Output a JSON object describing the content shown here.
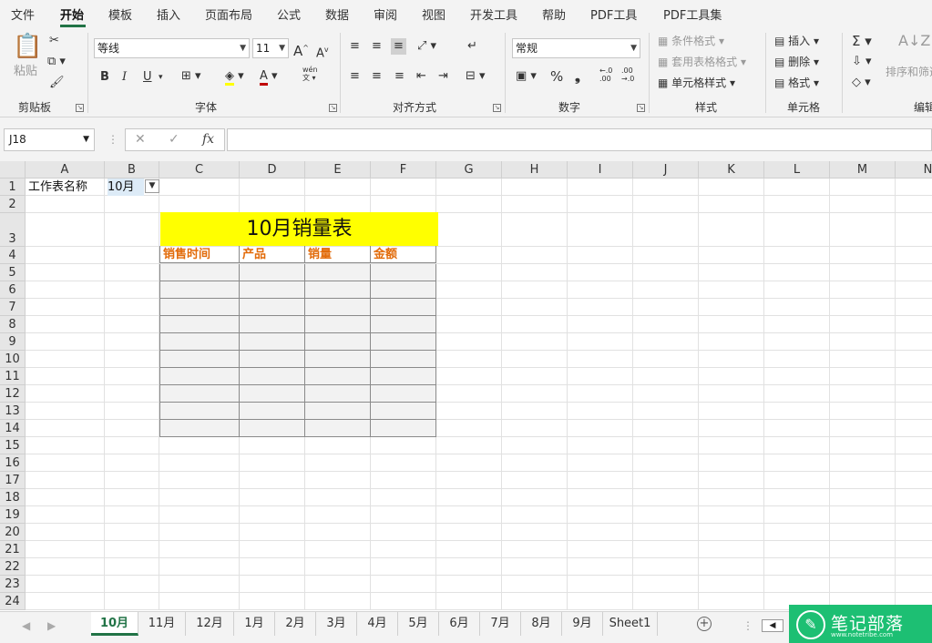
{
  "menu_tabs": [
    "文件",
    "开始",
    "模板",
    "插入",
    "页面布局",
    "公式",
    "数据",
    "审阅",
    "视图",
    "开发工具",
    "帮助",
    "PDF工具",
    "PDF工具集"
  ],
  "active_tab": "开始",
  "ribbon": {
    "clipboard": {
      "label": "剪贴板",
      "paste": "粘贴"
    },
    "font": {
      "label": "字体",
      "name": "等线",
      "size": "11",
      "grow": "A",
      "shrink": "A",
      "bold": "B",
      "italic": "I",
      "underline": "U",
      "phonetic": "wén"
    },
    "alignment": {
      "label": "对齐方式"
    },
    "number": {
      "label": "数字",
      "format": "常规",
      "percent": "%",
      "comma": "❟",
      "inc_decimal": "←.0\n.00",
      "dec_decimal": ".00\n→.0"
    },
    "styles": {
      "label": "样式",
      "conditional": "条件格式",
      "table_format": "套用表格格式",
      "cell_styles": "单元格样式"
    },
    "cells": {
      "label": "单元格",
      "insert": "插入",
      "delete": "删除",
      "format": "格式"
    },
    "editing": {
      "label": "编辑",
      "sort_filter": "排序和筛选"
    }
  },
  "formula_bar": {
    "name_box": "J18",
    "fx": "fx",
    "content": ""
  },
  "columns": [
    "A",
    "B",
    "C",
    "D",
    "E",
    "F",
    "G",
    "H",
    "I",
    "J",
    "K",
    "L",
    "M",
    "N"
  ],
  "rows": [
    "1",
    "2",
    "3",
    "4",
    "5",
    "6",
    "7",
    "8",
    "9",
    "10",
    "11",
    "12",
    "13",
    "14",
    "15",
    "16",
    "17",
    "18",
    "19",
    "20",
    "21",
    "22",
    "23",
    "24"
  ],
  "cells": {
    "A1": "工作表名称",
    "B1": "10月"
  },
  "table": {
    "title": "10月销量表",
    "headers": [
      "销售时间",
      "产品",
      "销量",
      "金额"
    ],
    "header_color": "#e26b0a",
    "title_bg": "#ffff00",
    "cell_bg": "#f2f2f2"
  },
  "sheet_tabs": [
    "10月",
    "11月",
    "12月",
    "1月",
    "2月",
    "3月",
    "4月",
    "5月",
    "6月",
    "7月",
    "8月",
    "9月",
    "Sheet1"
  ],
  "active_sheet": "10月",
  "watermark": {
    "text": "笔记部落",
    "url": "www.notetribe.com"
  }
}
